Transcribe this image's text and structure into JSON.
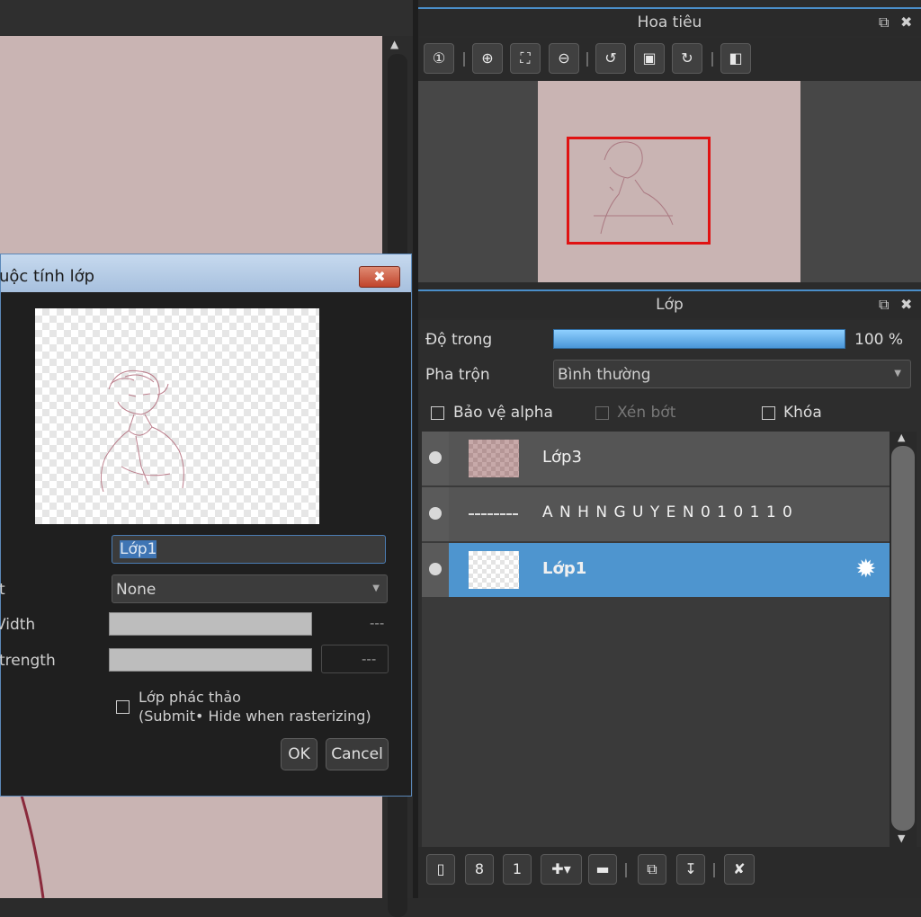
{
  "navigator": {
    "title": "Hoa tiêu",
    "toolbar": [
      {
        "name": "zoom-actual-icon",
        "glyph": "①"
      },
      {
        "name": "zoom-in-icon",
        "glyph": "⊕"
      },
      {
        "name": "fit-window-icon",
        "glyph": "⛶"
      },
      {
        "name": "zoom-out-icon",
        "glyph": "⊖"
      },
      {
        "name": "rotate-left-icon",
        "glyph": "↺"
      },
      {
        "name": "fit-rotate-icon",
        "glyph": "▣"
      },
      {
        "name": "rotate-right-icon",
        "glyph": "↻"
      },
      {
        "name": "flip-horizontal-icon",
        "glyph": "◧"
      }
    ]
  },
  "dialog": {
    "title": "uộc tính lớp",
    "close_glyph": "✖",
    "name_label": "",
    "name_value": "Lớp1",
    "option_label": "t",
    "option_value": "None",
    "width_label": "Vidth",
    "width_value": "---",
    "strength_label": "trength",
    "strength_value": "---",
    "sketch_line1": "Lớp phác thảo",
    "sketch_line2": "(Submit• Hide when rasterizing)",
    "ok": "OK",
    "cancel": "Cancel"
  },
  "layers": {
    "title": "Lớp",
    "opacity_label": "Độ trong",
    "opacity_value": "100 %",
    "opacity_fraction": 1.0,
    "blend_label": "Pha trộn",
    "blend_value": "Bình thường",
    "protect_alpha": "Bảo vệ alpha",
    "clipping": "Xén bớt",
    "lock": "Khóa",
    "items": [
      {
        "name": "Lớp3",
        "selected": false
      },
      {
        "name": "A N H N G U Y E N 0 1 0 1 1 0",
        "selected": false
      },
      {
        "name": "Lớp1",
        "selected": true
      }
    ],
    "toolbar": [
      {
        "name": "new-layer-icon",
        "glyph": "▯"
      },
      {
        "name": "new-8bit-layer-icon",
        "glyph": "8"
      },
      {
        "name": "new-1bit-layer-icon",
        "glyph": "1"
      },
      {
        "name": "add-layer-menu-icon",
        "glyph": "✚▾"
      },
      {
        "name": "new-folder-icon",
        "glyph": "▬"
      },
      {
        "name": "duplicate-layer-icon",
        "glyph": "⧉"
      },
      {
        "name": "merge-down-icon",
        "glyph": "↧"
      },
      {
        "name": "delete-layer-icon",
        "glyph": "✘"
      }
    ]
  },
  "window_icons": {
    "popout": "⧉",
    "close": "✖"
  },
  "colors": {
    "accent": "#4e95cf",
    "canvas": "#c9b4b3",
    "nav_frame": "#e01212"
  }
}
